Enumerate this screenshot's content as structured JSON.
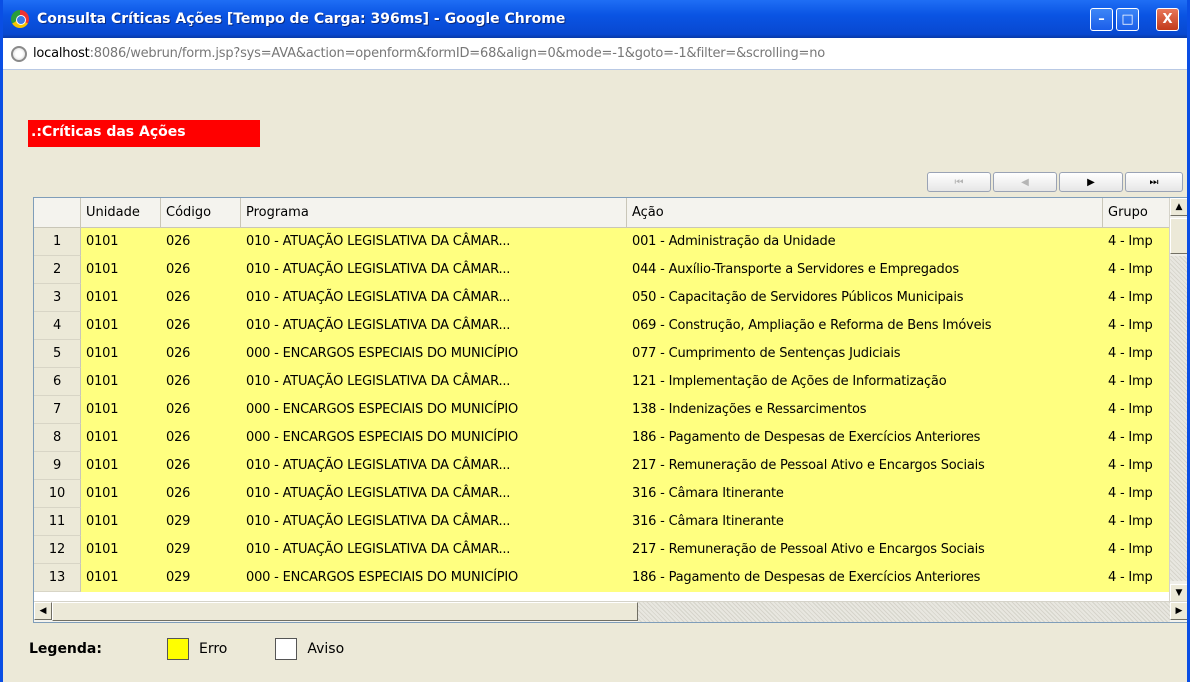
{
  "window": {
    "title": "Consulta Críticas Ações [Tempo de Carga: 396ms] - Google Chrome",
    "url_host": "localhost",
    "url_rest": ":8086/webrun/form.jsp?sys=AVA&action=openform&formID=68&align=0&mode=-1&goto=-1&filter=&scrolling=no",
    "controls": {
      "minimize": "–",
      "maximize": "□",
      "close": "X"
    }
  },
  "page": {
    "section_title": ".:Críticas das Ações",
    "nav": {
      "first": "⏮",
      "prev": "◀",
      "next": "▶",
      "last": "⏭"
    },
    "colors": {
      "error": "#ffff00",
      "warning": "#ffffff",
      "header_red": "#ff0000"
    }
  },
  "grid": {
    "headers": [
      "",
      "Unidade",
      "Código",
      "Programa",
      "Ação",
      "Grupo"
    ],
    "rows": [
      {
        "n": "1",
        "unidade": "0101",
        "codigo": "026",
        "programa": "010 - ATUAÇÃO LEGISLATIVA DA CÂMAR...",
        "acao": "001 - Administração da Unidade",
        "grupo": "4 - Imp"
      },
      {
        "n": "2",
        "unidade": "0101",
        "codigo": "026",
        "programa": "010 - ATUAÇÃO LEGISLATIVA DA CÂMAR...",
        "acao": "044 - Auxílio-Transporte a Servidores e Empregados",
        "grupo": "4 - Imp"
      },
      {
        "n": "3",
        "unidade": "0101",
        "codigo": "026",
        "programa": "010 - ATUAÇÃO LEGISLATIVA DA CÂMAR...",
        "acao": "050 - Capacitação de Servidores Públicos Municipais",
        "grupo": "4 - Imp"
      },
      {
        "n": "4",
        "unidade": "0101",
        "codigo": "026",
        "programa": "010 - ATUAÇÃO LEGISLATIVA DA CÂMAR...",
        "acao": "069 - Construção, Ampliação e Reforma de Bens Imóveis",
        "grupo": "4 - Imp"
      },
      {
        "n": "5",
        "unidade": "0101",
        "codigo": "026",
        "programa": "000 - ENCARGOS ESPECIAIS DO MUNICÍPIO",
        "acao": "077 - Cumprimento de Sentenças Judiciais",
        "grupo": "4 - Imp"
      },
      {
        "n": "6",
        "unidade": "0101",
        "codigo": "026",
        "programa": "010 - ATUAÇÃO LEGISLATIVA DA CÂMAR...",
        "acao": "121 - Implementação de Ações de Informatização",
        "grupo": "4 - Imp"
      },
      {
        "n": "7",
        "unidade": "0101",
        "codigo": "026",
        "programa": "000 - ENCARGOS ESPECIAIS DO MUNICÍPIO",
        "acao": "138 - Indenizações e Ressarcimentos",
        "grupo": "4 - Imp"
      },
      {
        "n": "8",
        "unidade": "0101",
        "codigo": "026",
        "programa": "000 - ENCARGOS ESPECIAIS DO MUNICÍPIO",
        "acao": "186 - Pagamento de Despesas de Exercícios Anteriores",
        "grupo": "4 - Imp"
      },
      {
        "n": "9",
        "unidade": "0101",
        "codigo": "026",
        "programa": "010 - ATUAÇÃO LEGISLATIVA DA CÂMAR...",
        "acao": "217 - Remuneração de Pessoal Ativo e Encargos Sociais",
        "grupo": "4 - Imp"
      },
      {
        "n": "10",
        "unidade": "0101",
        "codigo": "026",
        "programa": "010 - ATUAÇÃO LEGISLATIVA DA CÂMAR...",
        "acao": "316 - Câmara Itinerante",
        "grupo": "4 - Imp"
      },
      {
        "n": "11",
        "unidade": "0101",
        "codigo": "029",
        "programa": "010 - ATUAÇÃO LEGISLATIVA DA CÂMAR...",
        "acao": "316 - Câmara Itinerante",
        "grupo": "4 - Imp"
      },
      {
        "n": "12",
        "unidade": "0101",
        "codigo": "029",
        "programa": "010 - ATUAÇÃO LEGISLATIVA DA CÂMAR...",
        "acao": "217 - Remuneração de Pessoal Ativo e Encargos Sociais",
        "grupo": "4 - Imp"
      },
      {
        "n": "13",
        "unidade": "0101",
        "codigo": "029",
        "programa": "000 - ENCARGOS ESPECIAIS DO MUNICÍPIO",
        "acao": "186 - Pagamento de Despesas de Exercícios Anteriores",
        "grupo": "4 - Imp"
      }
    ]
  },
  "legend": {
    "label": "Legenda:",
    "items": [
      {
        "label": "Erro",
        "color": "#ffff00"
      },
      {
        "label": "Aviso",
        "color": "#ffffff"
      }
    ]
  }
}
